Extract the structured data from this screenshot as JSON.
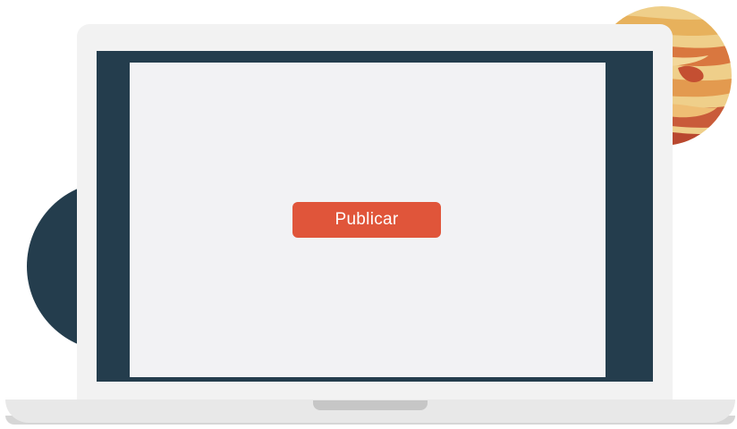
{
  "screen": {
    "button_label": "Publicar"
  },
  "colors": {
    "bezel": "#243d4d",
    "dark_planet": "#243d4d",
    "button": "#e0553a",
    "screen": "#f2f2f4"
  }
}
